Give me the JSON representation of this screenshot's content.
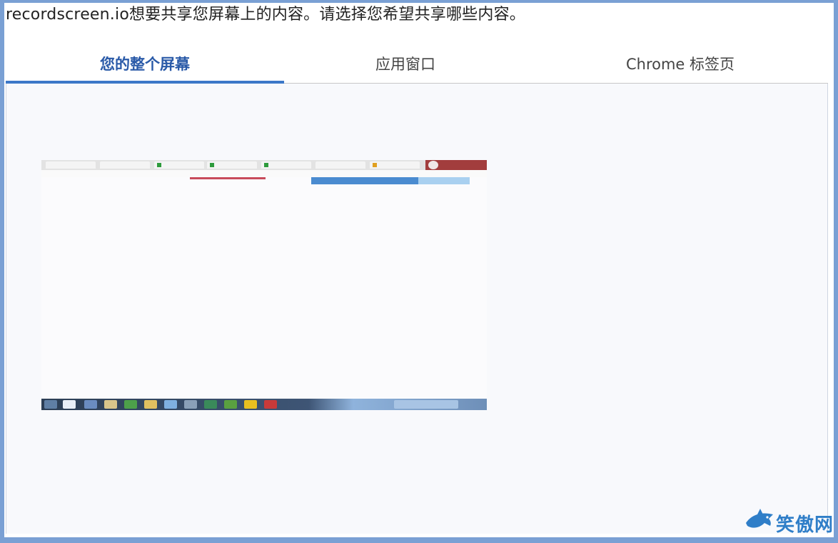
{
  "prompt": {
    "text": "recordscreen.io想要共享您屏幕上的内容。请选择您希望共享哪些内容。"
  },
  "tabs": [
    {
      "label": "您的整个屏幕",
      "selected": true
    },
    {
      "label": "应用窗口",
      "selected": false
    },
    {
      "label": "Chrome 标签页",
      "selected": false
    }
  ],
  "colors": {
    "accent": "#3c78c8",
    "frame": "#7aa0d4"
  },
  "watermark": {
    "text": "笑傲网",
    "icon": "shark-logo-icon"
  }
}
